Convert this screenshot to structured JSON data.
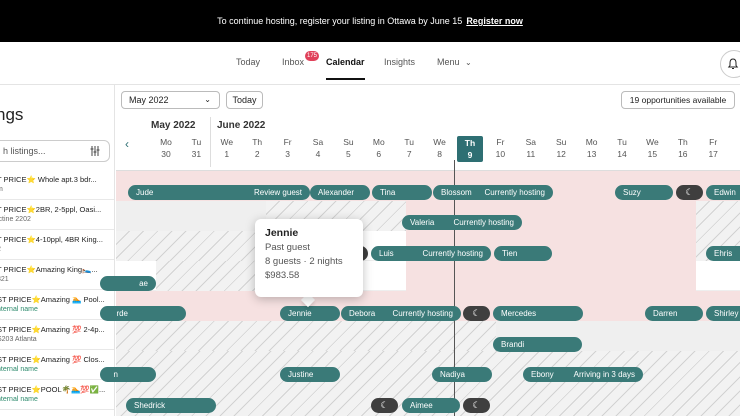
{
  "banner": {
    "text": "To continue hosting, register your listing in Ottawa by June 15",
    "link": "Register now"
  },
  "nav": {
    "today": "Today",
    "inbox": "Inbox",
    "inbox_badge": "175",
    "calendar": "Calendar",
    "insights": "Insights",
    "menu": "Menu"
  },
  "sidebar": {
    "title": "ngs",
    "search_placeholder": "h listings...",
    "listings": [
      {
        "title": "T PRICE⭐ Whole apt.3 bdr...",
        "sub": "m",
        "green": false
      },
      {
        "title": "T PRICE⭐2BR, 2-5ppl, Oasi...",
        "sub": "ictine 2202",
        "green": false
      },
      {
        "title": "T PRICE⭐4-10ppl, 4BR King...",
        "sub": "2",
        "green": false
      },
      {
        "title": "T PRICE⭐Amazing King🛌...",
        "sub": "321",
        "green": false
      },
      {
        "title": "ST PRICE⭐Amazing 🏊 Pool...",
        "sub": "nternal name",
        "green": true
      },
      {
        "title": "ST PRICE⭐Amazing 💯 2-4p...",
        "sub": "S203 Atlanta",
        "green": false
      },
      {
        "title": "ST PRICE⭐Amazing 💯 Clos...",
        "sub": "nternal name",
        "green": true
      },
      {
        "title": "ST PRICE⭐POOL🌴🏊💯✅...",
        "sub": "nternal name",
        "green": true
      }
    ]
  },
  "toolbar": {
    "month": "May 2022",
    "today": "Today",
    "opportunities": "19 opportunities available"
  },
  "calendar": {
    "months": [
      "May 2022",
      "June 2022"
    ],
    "days": [
      {
        "dow": "Mo",
        "num": "30"
      },
      {
        "dow": "Tu",
        "num": "31"
      },
      {
        "dow": "We",
        "num": "1"
      },
      {
        "dow": "Th",
        "num": "2"
      },
      {
        "dow": "Fr",
        "num": "3"
      },
      {
        "dow": "Sa",
        "num": "4"
      },
      {
        "dow": "Su",
        "num": "5"
      },
      {
        "dow": "Mo",
        "num": "6"
      },
      {
        "dow": "Tu",
        "num": "7"
      },
      {
        "dow": "We",
        "num": "8"
      },
      {
        "dow": "Th",
        "num": "9"
      },
      {
        "dow": "Fr",
        "num": "10"
      },
      {
        "dow": "Sa",
        "num": "11"
      },
      {
        "dow": "Su",
        "num": "12"
      },
      {
        "dow": "Mo",
        "num": "13"
      },
      {
        "dow": "Tu",
        "num": "14"
      },
      {
        "dow": "We",
        "num": "15"
      },
      {
        "dow": "Th",
        "num": "16"
      },
      {
        "dow": "Fr",
        "num": "17"
      }
    ],
    "bookings": {
      "jude": "Jude",
      "jude_status": "Review guest",
      "alexander": "Alexander",
      "tina": "Tina",
      "blossom": "Blossom",
      "blossom_status": "Currently hosting",
      "suzy": "Suzy",
      "edwin": "Edwin",
      "valeria": "Valeria",
      "valeria_status": "Currently hosting",
      "luis": "Luis",
      "luis_status": "Currently hosting",
      "tien": "Tien",
      "ehris": "Ehris",
      "ae": "ae",
      "rde": "rde",
      "jennie": "Jennie",
      "debora": "Debora",
      "debora_status": "Currently hosting",
      "mercedes": "Mercedes",
      "darren": "Darren",
      "shirley": "Shirley",
      "brandi": "Brandi",
      "n": "n",
      "justine": "Justine",
      "nadiya": "Nadiya",
      "ebony": "Ebony",
      "ebony_status": "Arriving in 3 days",
      "shedrick": "Shedrick",
      "aimee": "Aimee"
    }
  },
  "tooltip": {
    "name": "Jennie",
    "status": "Past guest",
    "detail": "8 guests · 2 nights",
    "price": "$983.58"
  }
}
